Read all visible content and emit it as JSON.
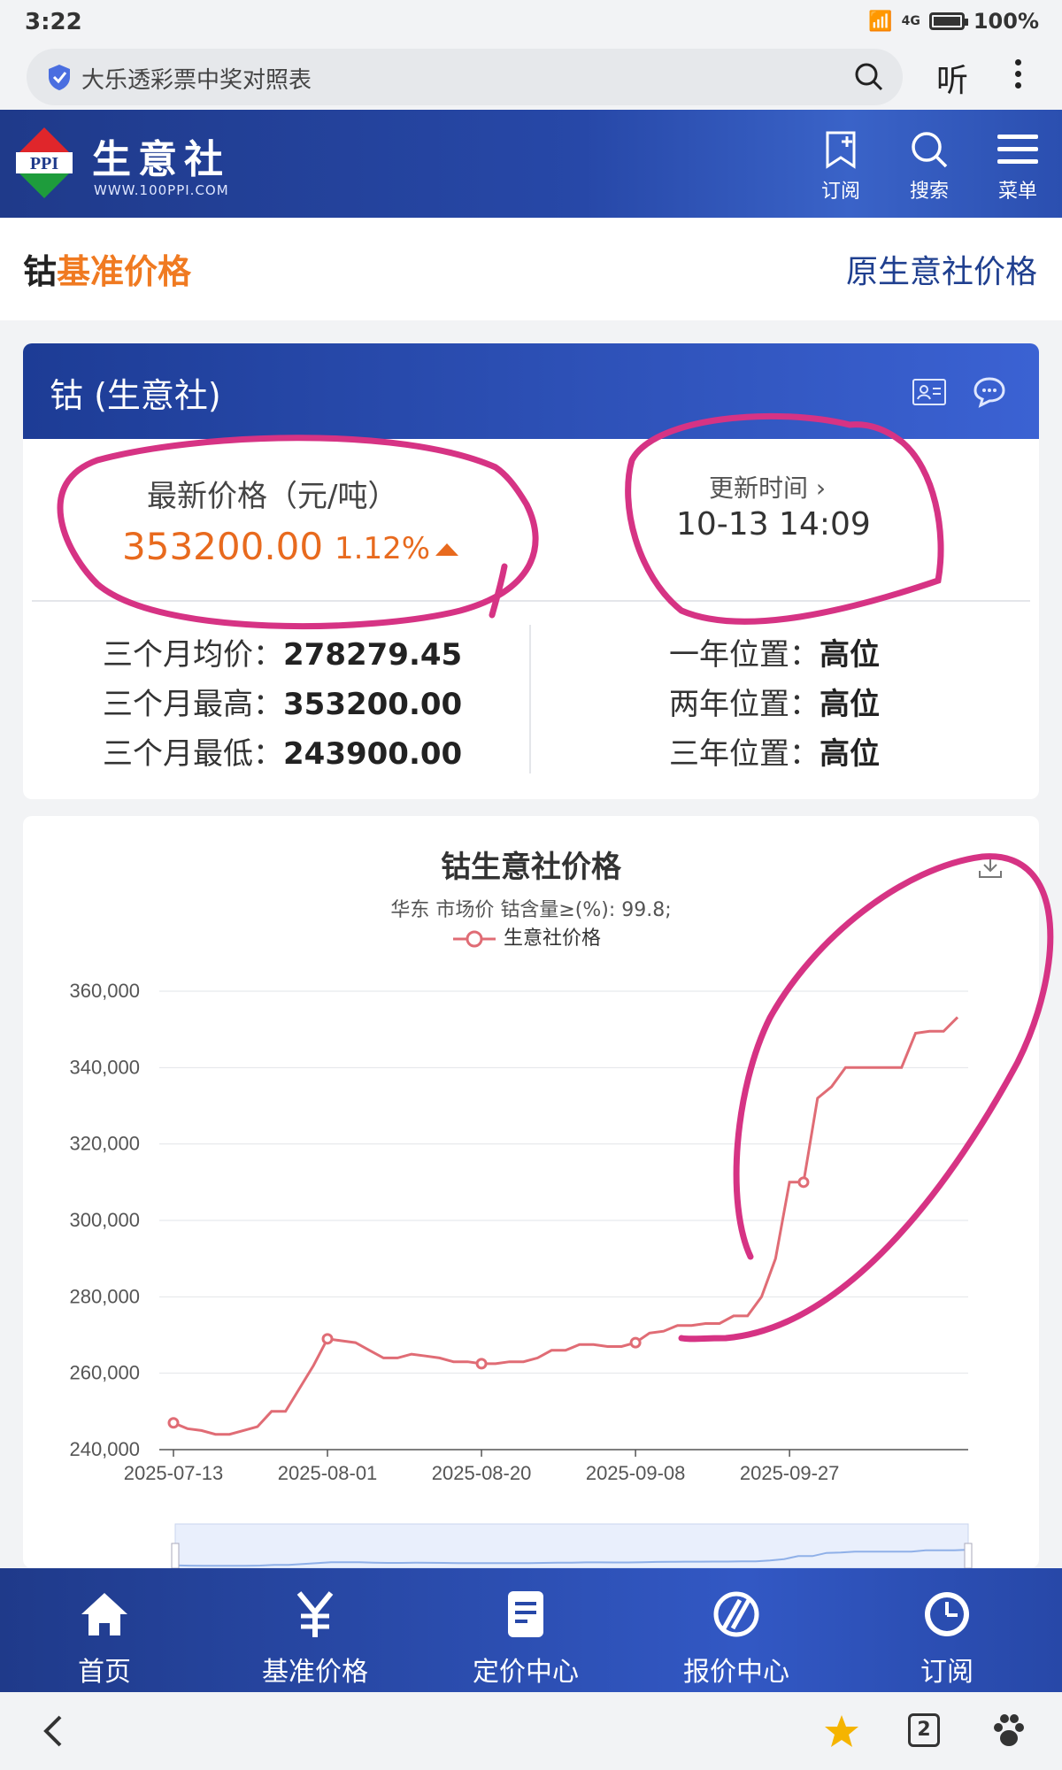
{
  "status": {
    "time": "3:22",
    "battery": "100%",
    "net": "4G"
  },
  "browser": {
    "url_text": "大乐透彩票中奖对照表",
    "listen": "听"
  },
  "header": {
    "brand": "生意社",
    "site": "WWW.100PPI.COM",
    "logo_text": "PPI",
    "buttons": [
      {
        "label": "订阅",
        "icon": "bookmark-plus-icon"
      },
      {
        "label": "搜索",
        "icon": "search-icon"
      },
      {
        "label": "菜单",
        "icon": "menu-icon"
      }
    ]
  },
  "page": {
    "title_a": "钴",
    "title_b": "基准价格",
    "orig_link": "原生意社价格"
  },
  "card": {
    "name": "钴 (生意社)",
    "latest_label": "最新价格（元/吨）",
    "latest_price": "353200.00",
    "change": "1.12%",
    "update_label": "更新时间 ›",
    "update_time": "10-13 14:09",
    "left_stats": [
      {
        "k": "三个月均价：",
        "v": "278279.45"
      },
      {
        "k": "三个月最高：",
        "v": "353200.00"
      },
      {
        "k": "三个月最低：",
        "v": "243900.00"
      }
    ],
    "right_stats": [
      {
        "k": "一年位置：",
        "v": "高位"
      },
      {
        "k": "两年位置：",
        "v": "高位"
      },
      {
        "k": "三年位置：",
        "v": "高位"
      }
    ]
  },
  "chart_data": {
    "type": "line",
    "title": "钴生意社价格",
    "subtitle": "华东 市场价 钴含量≥(%): 99.8;",
    "legend": "生意社价格",
    "series_color": "#e06c75",
    "xlabels": [
      "2025-07-13",
      "2025-08-01",
      "2025-08-20",
      "2025-09-08",
      "2025-09-27"
    ],
    "yticks": [
      "360,000",
      "340,000",
      "320,000",
      "300,000",
      "280,000",
      "260,000",
      "240,000"
    ],
    "ylim": [
      240000,
      360000
    ],
    "grid": true,
    "values": [
      247000,
      245500,
      245000,
      244000,
      244000,
      245000,
      246000,
      250000,
      250000,
      256000,
      262000,
      269000,
      268500,
      268000,
      266000,
      264000,
      264000,
      265000,
      264500,
      264000,
      263000,
      263000,
      262500,
      262500,
      263000,
      263000,
      264000,
      266000,
      266000,
      267500,
      267500,
      267000,
      267000,
      268000,
      270500,
      271000,
      272500,
      272500,
      273000,
      273000,
      275000,
      275000,
      280000,
      290000,
      310000,
      310000,
      332000,
      335000,
      340000,
      340000,
      340000,
      340000,
      340000,
      349000,
      349500,
      349500,
      353200
    ],
    "markers": [
      0,
      11,
      22,
      33,
      45
    ],
    "x_start_day": 0,
    "x_days_total": 84
  },
  "bottom_nav": [
    {
      "label": "首页",
      "icon": "home-icon"
    },
    {
      "label": "基准价格",
      "icon": "yen-icon"
    },
    {
      "label": "定价中心",
      "icon": "document-icon"
    },
    {
      "label": "报价中心",
      "icon": "no-sign-icon"
    },
    {
      "label": "订阅",
      "icon": "clock-icon"
    }
  ],
  "sysbar": {
    "tabs": "2"
  }
}
